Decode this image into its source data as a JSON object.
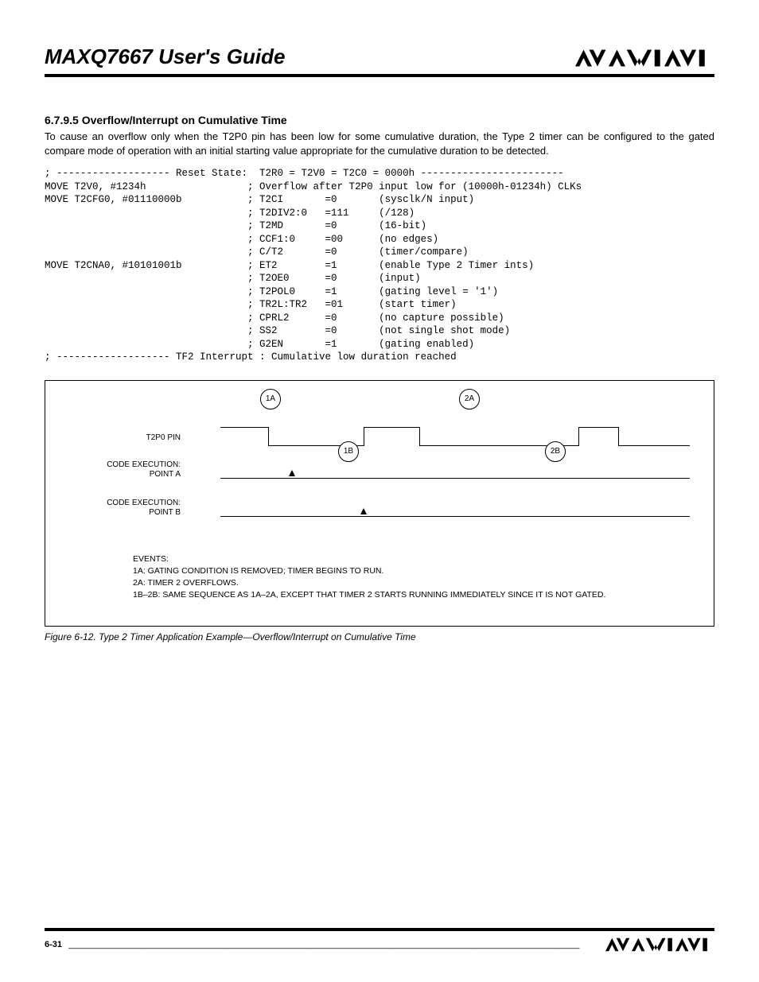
{
  "header": {
    "title": "MAXQ7667 User's Guide",
    "brand": "MAXIM"
  },
  "section": {
    "number_title": "6.7.9.5 Overflow/Interrupt on Cumulative Time",
    "description": "To cause an overflow only when the T2P0 pin has been low for some cumulative duration, the Type 2 timer can be configured to the gated compare mode of operation with an initial starting value appropriate for the cumulative duration to be detected."
  },
  "code": "; ------------------- Reset State:  T2R0 = T2V0 = T2C0 = 0000h ------------------------\nMOVE T2V0, #1234h                 ; Overflow after T2P0 input low for (10000h-01234h) CLKs\nMOVE T2CFG0, #01110000b           ; T2CI       =0       (sysclk/N input)\n                                  ; T2DIV2:0   =111     (/128)\n                                  ; T2MD       =0       (16-bit)\n                                  ; CCF1:0     =00      (no edges)\n                                  ; C/T2       =0       (timer/compare)\nMOVE T2CNA0, #10101001b           ; ET2        =1       (enable Type 2 Timer ints)\n                                  ; T2OE0      =0       (input)\n                                  ; T2POL0     =1       (gating level = '1')\n                                  ; TR2L:TR2   =01      (start timer)\n                                  ; CPRL2      =0       (no capture possible)\n                                  ; SS2        =0       (not single shot mode)\n                                  ; G2EN       =1       (gating enabled)\n; ------------------- TF2 Interrupt : Cumulative low duration reached",
  "diagram": {
    "row1_label": "T2P0 PIN",
    "row2_label": "CODE EXECUTION:\nPOINT A",
    "row3_label": "CODE EXECUTION:\nPOINT B",
    "markers": {
      "m1a": "1A",
      "m2a": "2A",
      "m1b": "1B",
      "m2b": "2B"
    },
    "events_title": "EVENTS:",
    "events": [
      "1A: GATING CONDITION IS REMOVED; TIMER BEGINS TO RUN.",
      "2A: TIMER 2 OVERFLOWS.",
      "1B–2B: SAME SEQUENCE AS 1A–2A, EXCEPT THAT TIMER 2 STARTS RUNNING IMMEDIATELY SINCE IT IS NOT GATED."
    ]
  },
  "figure_caption": "Figure 6-12. Type 2 Timer Application Example—Overflow/Interrupt on Cumulative Time",
  "footer": {
    "page_number": "6-31",
    "fill": "_________________________________________________________________________________________________________",
    "brand": "MAXIM"
  }
}
